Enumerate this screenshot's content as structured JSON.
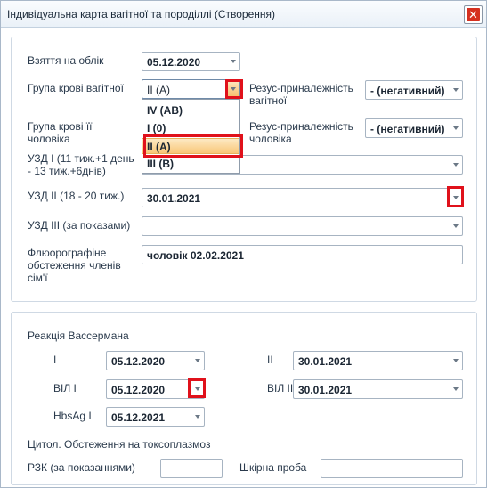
{
  "window": {
    "title": "Індивідуальна карта вагітної та породіллі (Створення)"
  },
  "colors": {
    "highlight": "#e0111b",
    "selected_bg": "#f9c778",
    "close_bg": "#d5301f"
  },
  "form": {
    "registration_label": "Взяття на облік",
    "registration_value": "05.12.2020",
    "blood_group_label": "Група крові вагітної",
    "blood_group_value": "II (A)",
    "rh_label": "Резус-приналежність вагітної",
    "rh_value": "- (негативний)",
    "husband_blood_label": "Група крові її чоловіка",
    "husband_rh_label": "Резус-приналежність чоловіка",
    "husband_rh_value": "- (негативний)",
    "uzd1_label": "УЗД I (11 тиж.+1 день - 13 тиж.+6днів)",
    "uzd2_label": "УЗД II (18 - 20 тиж.)",
    "uzd2_value": "30.01.2021",
    "uzd3_label": "УЗД III (за показами)",
    "fluoro_label": "Флюорографіне обстеження членів сім'ї",
    "fluoro_value": "чоловік  02.02.2021"
  },
  "blood_group_options": [
    "IV (AB)",
    "I (0)",
    "II (A)",
    "III (B)"
  ],
  "wasserman": {
    "section_label": "Реакція Вассермана",
    "i_label": "I",
    "i_value": "05.12.2020",
    "ii_label": "II",
    "ii_value": "30.01.2021",
    "hiv1_label": "ВІЛ I",
    "hiv1_value": "05.12.2020",
    "hiv2_label": "ВІЛ II",
    "hiv2_value": "30.01.2021",
    "hbsag_label": "HbsAg I",
    "hbsag_value": "05.12.2021",
    "toxo_label": "Цитол. Обстеження на токсоплазмоз",
    "rzk_label": "РЗК (за показаннями)",
    "skin_label": "Шкірна проба"
  }
}
